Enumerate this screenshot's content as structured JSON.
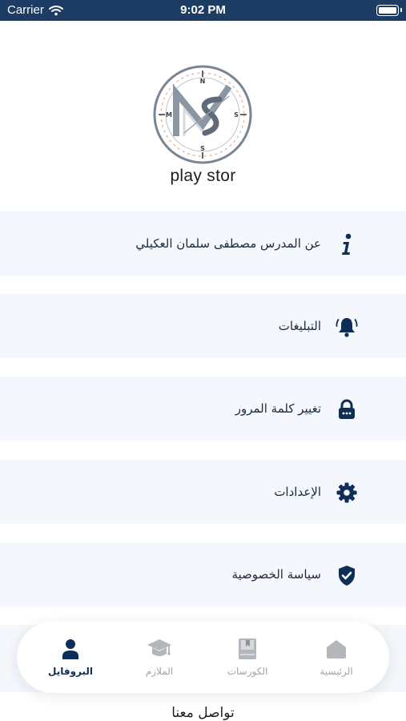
{
  "status_bar": {
    "carrier": "Carrier",
    "time": "9:02 PM"
  },
  "logo": {
    "brand_letters": "MS",
    "compass_points": [
      "N",
      "S",
      "M",
      "S"
    ]
  },
  "app_name": "play stor",
  "menu": [
    {
      "label": "عن المدرس مصطفى سلمان العكيلي",
      "icon": "info-icon"
    },
    {
      "label": "التبليغات",
      "icon": "bell-icon"
    },
    {
      "label": "تغيير كلمة المرور",
      "icon": "lock-icon"
    },
    {
      "label": "الإعدادات",
      "icon": "gear-icon"
    },
    {
      "label": "سياسة الخصوصية",
      "icon": "shield-check-icon"
    }
  ],
  "contact": {
    "label": "تواصل معنا"
  },
  "bottom_nav": [
    {
      "label": "الرئيسية",
      "icon": "home-icon",
      "active": false
    },
    {
      "label": "الكورسات",
      "icon": "book-icon",
      "active": false
    },
    {
      "label": "الملازم",
      "icon": "graduation-cap-icon",
      "active": false
    },
    {
      "label": "البروفايل",
      "icon": "person-icon",
      "active": true
    }
  ],
  "colors": {
    "status_bar": "#1d3c63",
    "primary": "#0e2e57",
    "menu_bg": "#f4f7fb",
    "inactive": "#a0a5ab"
  }
}
